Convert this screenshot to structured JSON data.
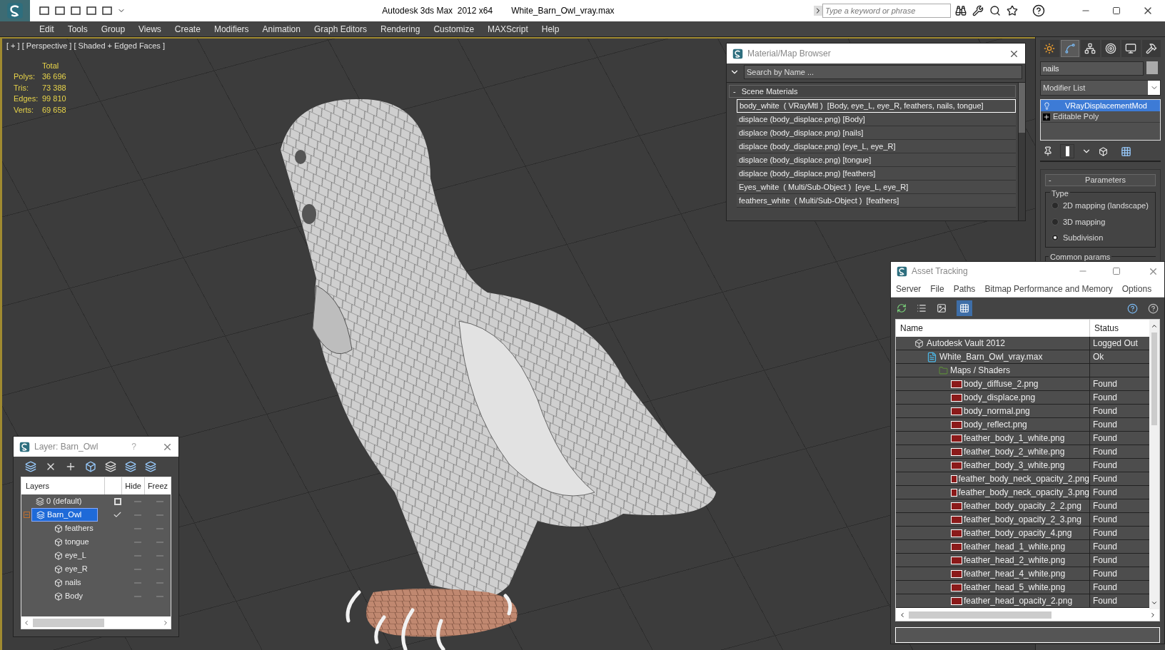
{
  "window": {
    "title": "Autodesk 3ds Max  2012 x64",
    "file": "White_Barn_Owl_vray.max",
    "search_placeholder": "Type a keyword or phrase"
  },
  "menu": [
    "Edit",
    "Tools",
    "Group",
    "Views",
    "Create",
    "Modifiers",
    "Animation",
    "Graph Editors",
    "Rendering",
    "Customize",
    "MAXScript",
    "Help"
  ],
  "viewport": {
    "label": "[ + ] [ Perspective ] [ Shaded + Edged Faces ]",
    "stats_header": "Total",
    "stats": [
      {
        "label": "Polys:",
        "value": "36 696"
      },
      {
        "label": "Tris:",
        "value": "73 388"
      },
      {
        "label": "Edges:",
        "value": "99 810"
      },
      {
        "label": "Verts:",
        "value": "69 658"
      }
    ]
  },
  "material_browser": {
    "title": "Material/Map Browser",
    "search_placeholder": "Search by Name ...",
    "group": {
      "sign": "-",
      "label": "Scene Materials",
      "expanded": true
    },
    "items": [
      {
        "label": "body_white  ( VRayMtl )  [Body, eye_L, eye_R, feathers, nails, tongue]",
        "selected": true
      },
      {
        "label": "displace (body_displace.png) [Body]",
        "selected": false
      },
      {
        "label": "displace (body_displace.png) [nails]",
        "selected": false
      },
      {
        "label": "displace (body_displace.png) [eye_L, eye_R]",
        "selected": false
      },
      {
        "label": "displace (body_displace.png) [tongue]",
        "selected": false
      },
      {
        "label": "displace (body_displace.png) [feathers]",
        "selected": false
      },
      {
        "label": "Eyes_white  ( Multi/Sub-Object )  [eye_L, eye_R]",
        "selected": false
      },
      {
        "label": "feathers_white  ( Multi/Sub-Object )  [feathers]",
        "selected": false
      }
    ]
  },
  "command_panel": {
    "tabs": [
      {
        "kind": "create",
        "selected": false
      },
      {
        "kind": "modify",
        "selected": true
      },
      {
        "kind": "hierarchy",
        "selected": false
      },
      {
        "kind": "motion",
        "selected": false
      },
      {
        "kind": "display",
        "selected": false
      },
      {
        "kind": "utilities",
        "selected": false
      }
    ],
    "object_name": "nails",
    "modifier_list": "Modifier List",
    "stack": [
      {
        "kind": "modifier",
        "label": "VRayDisplacementMod",
        "selected": true
      },
      {
        "kind": "base",
        "label": "Editable Poly",
        "selected": false
      }
    ],
    "rollout": {
      "sign": "-",
      "title": "Parameters"
    },
    "type_group": "Type",
    "type_options": [
      {
        "label": "2D mapping (landscape)",
        "selected": false
      },
      {
        "label": "3D mapping",
        "selected": false
      },
      {
        "label": "Subdivision",
        "selected": true
      }
    ],
    "common_group": "Common params"
  },
  "layer_window": {
    "title": "Layer: Barn_Owl",
    "help": "?",
    "columns": [
      "Layers",
      "Hide",
      "Freez"
    ],
    "rows": [
      {
        "kind": "layer",
        "label": "0 (default)",
        "current": false,
        "selected": false
      },
      {
        "kind": "layer",
        "label": "Barn_Owl",
        "current": true,
        "selected": true,
        "expanded": true,
        "children": [
          {
            "kind": "object",
            "label": "feathers",
            "selected": false
          },
          {
            "kind": "object",
            "label": "tongue",
            "selected": false
          },
          {
            "kind": "object",
            "label": "eye_L",
            "selected": false
          },
          {
            "kind": "object",
            "label": "eye_R",
            "selected": false
          },
          {
            "kind": "object",
            "label": "nails",
            "selected": false
          },
          {
            "kind": "object",
            "label": "Body",
            "selected": false
          }
        ]
      }
    ]
  },
  "asset_tracking": {
    "title": "Asset Tracking",
    "menu": [
      "Server",
      "File",
      "Paths",
      "Bitmap Performance and Memory",
      "Options"
    ],
    "columns": [
      "Name",
      "Status"
    ],
    "rows": [
      {
        "kind": "vault",
        "name": "Autodesk Vault 2012",
        "status": "Logged Out",
        "children": [
          {
            "kind": "max",
            "name": "White_Barn_Owl_vray.max",
            "status": "Ok",
            "children": [
              {
                "kind": "folder",
                "name": "Maps / Shaders",
                "children": [
                  {
                    "kind": "png",
                    "name": "body_diffuse_2.png",
                    "status": "Found"
                  },
                  {
                    "kind": "png",
                    "name": "body_displace.png",
                    "status": "Found"
                  },
                  {
                    "kind": "png",
                    "name": "body_normal.png",
                    "status": "Found"
                  },
                  {
                    "kind": "png",
                    "name": "body_reflect.png",
                    "status": "Found"
                  },
                  {
                    "kind": "png",
                    "name": "feather_body_1_white.png",
                    "status": "Found"
                  },
                  {
                    "kind": "png",
                    "name": "feather_body_2_white.png",
                    "status": "Found"
                  },
                  {
                    "kind": "png",
                    "name": "feather_body_3_white.png",
                    "status": "Found"
                  },
                  {
                    "kind": "png",
                    "name": "feather_body_neck_opacity_2.png",
                    "status": "Found"
                  },
                  {
                    "kind": "png",
                    "name": "feather_body_neck_opacity_3.png",
                    "status": "Found"
                  },
                  {
                    "kind": "png",
                    "name": "feather_body_opacity_2_2.png",
                    "status": "Found"
                  },
                  {
                    "kind": "png",
                    "name": "feather_body_opacity_2_3.png",
                    "status": "Found"
                  },
                  {
                    "kind": "png",
                    "name": "feather_body_opacity_4.png",
                    "status": "Found"
                  },
                  {
                    "kind": "png",
                    "name": "feather_head_1_white.png",
                    "status": "Found"
                  },
                  {
                    "kind": "png",
                    "name": "feather_head_2_white.png",
                    "status": "Found"
                  },
                  {
                    "kind": "png",
                    "name": "feather_head_4_white.png",
                    "status": "Found"
                  },
                  {
                    "kind": "png",
                    "name": "feather_head_5_white.png",
                    "status": "Found"
                  },
                  {
                    "kind": "png",
                    "name": "feather_head_opacity_2.png",
                    "status": "Found"
                  }
                ]
              }
            ]
          }
        ]
      }
    ]
  }
}
